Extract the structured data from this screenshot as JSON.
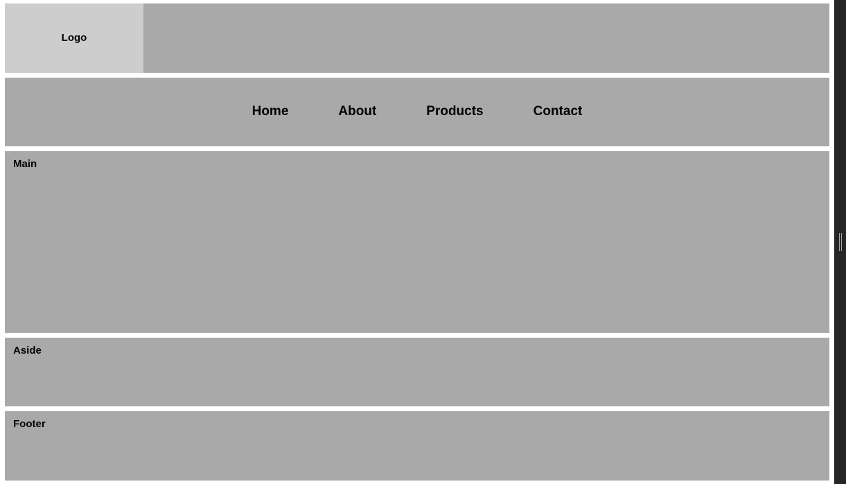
{
  "header": {
    "logo_label": "Logo"
  },
  "nav": {
    "items": [
      {
        "label": "Home"
      },
      {
        "label": "About"
      },
      {
        "label": "Products"
      },
      {
        "label": "Contact"
      }
    ]
  },
  "main": {
    "label": "Main"
  },
  "aside": {
    "label": "Aside"
  },
  "footer": {
    "label": "Footer"
  }
}
